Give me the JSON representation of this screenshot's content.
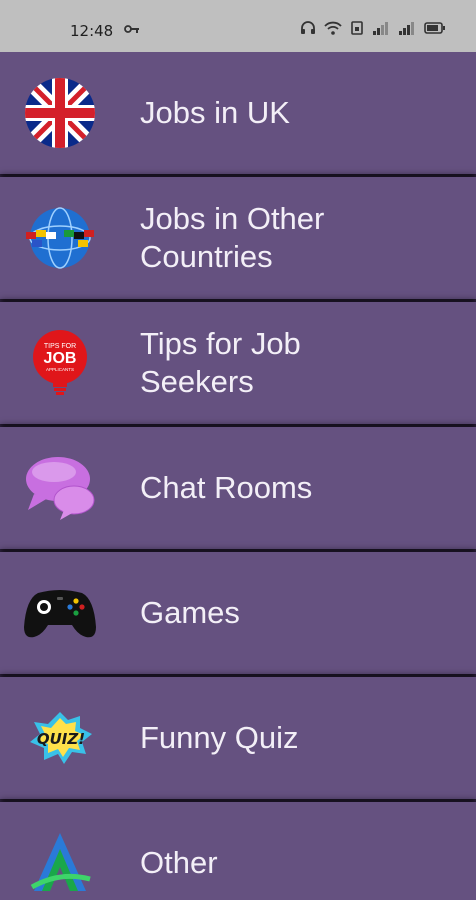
{
  "status_bar": {
    "time": "12:48",
    "icons": [
      "key-icon",
      "headset-icon",
      "wifi-icon",
      "sim-icon",
      "signal-icon",
      "signal-icon",
      "battery-icon"
    ]
  },
  "menu": {
    "items": [
      {
        "label": "Jobs in UK",
        "icon": "uk-flag-icon"
      },
      {
        "label": "Jobs in Other\nCountries",
        "icon": "globe-flags-icon"
      },
      {
        "label": "Tips for Job\nSeekers",
        "icon": "lightbulb-tips-icon"
      },
      {
        "label": "Chat Rooms",
        "icon": "chat-bubbles-icon"
      },
      {
        "label": "Games",
        "icon": "gamepad-icon"
      },
      {
        "label": "Funny Quiz",
        "icon": "quiz-icon"
      },
      {
        "label": "Other",
        "icon": "other-logo-icon"
      }
    ],
    "tips_icon_text": [
      "TIPS FOR",
      "JOB",
      "APPLICANTS"
    ],
    "quiz_icon_text": "QUIZ!"
  },
  "colors": {
    "row_background": "#655180",
    "text": "#f3eff7",
    "status_bar": "#bfbfbf"
  }
}
